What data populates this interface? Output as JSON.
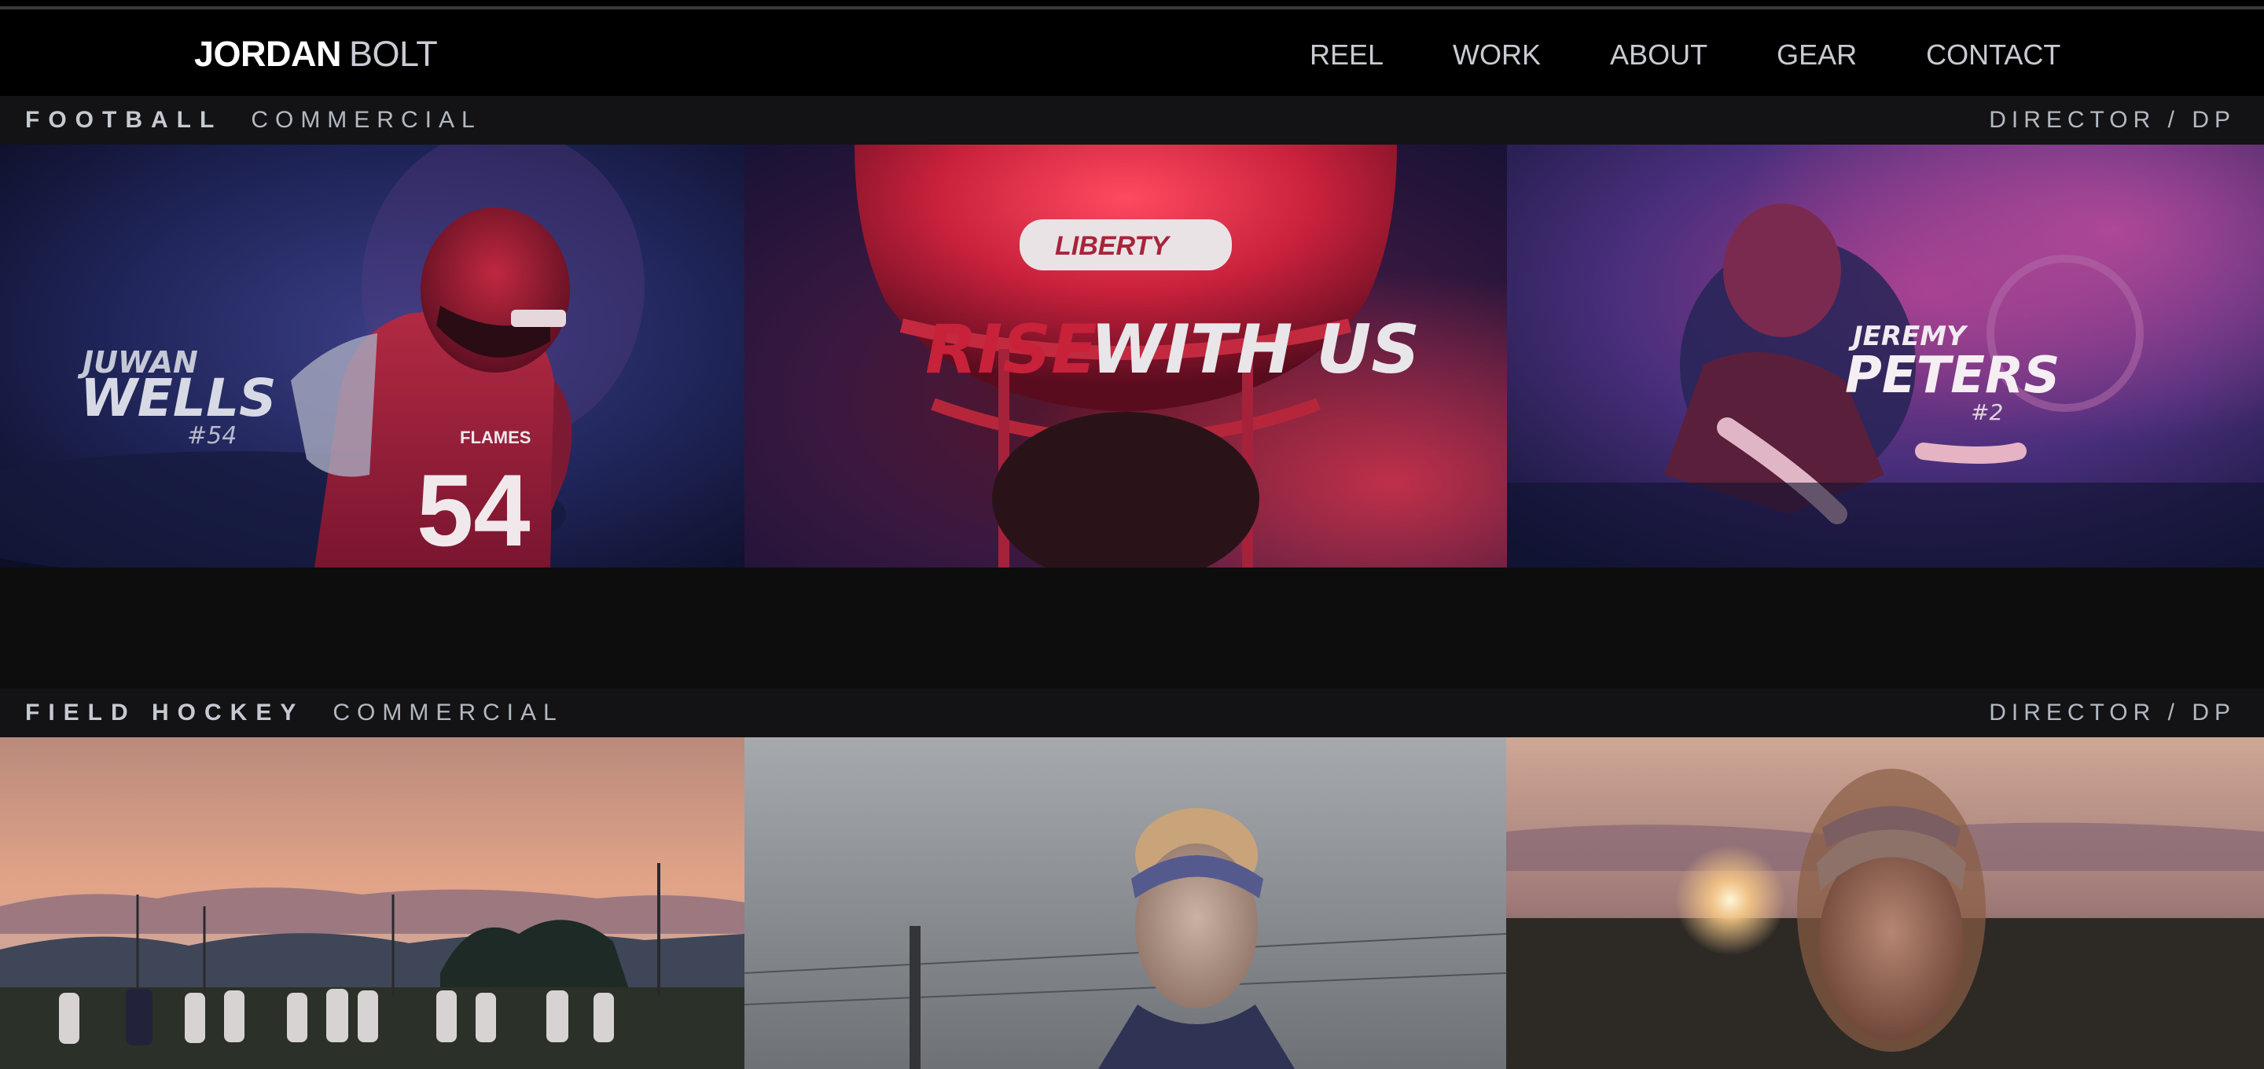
{
  "brand": {
    "first": "JORDAN",
    "last": "BOLT"
  },
  "nav": [
    {
      "label": "REEL"
    },
    {
      "label": "WORK"
    },
    {
      "label": "ABOUT"
    },
    {
      "label": "GEAR"
    },
    {
      "label": "CONTACT"
    }
  ],
  "sections": [
    {
      "title": "FOOTBALL",
      "kind": "COMMERCIAL",
      "role": "DIRECTOR / DP",
      "stills": [
        {
          "first_name": "JUWAN",
          "last_name": "WELLS",
          "number": "#54",
          "jersey": "54",
          "team": "FLAMES"
        },
        {
          "word1": "RISE",
          "word2": "WITH US",
          "helmet_brand": "LIBERTY"
        },
        {
          "first_name": "JEREMY",
          "last_name": "PETERS",
          "number": "#2"
        }
      ]
    },
    {
      "title": "FIELD HOCKEY",
      "kind": "COMMERCIAL",
      "role": "DIRECTOR / DP",
      "stills": [
        {
          "subject": "team at sunset"
        },
        {
          "subject": "player portrait, overcast"
        },
        {
          "subject": "player portrait, sunset"
        }
      ]
    }
  ],
  "colors": {
    "background": "#0d0d0e",
    "nav_background": "#000000",
    "accent_red": "#d2283c",
    "accent_blue": "#2a3a8c"
  }
}
